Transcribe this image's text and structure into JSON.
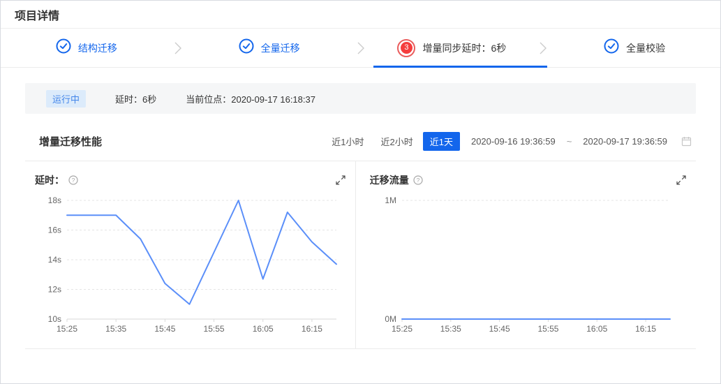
{
  "page": {
    "title": "项目详情"
  },
  "stepper": {
    "steps": [
      {
        "label": "结构迁移",
        "icon": "check-circle",
        "state": "done"
      },
      {
        "label": "全量迁移",
        "icon": "check-circle",
        "state": "done"
      },
      {
        "label": "增量同步延时：6秒",
        "icon": "number-badge",
        "badge": "3",
        "state": "active"
      },
      {
        "label": "全量校验",
        "icon": "check-circle",
        "state": "done"
      }
    ]
  },
  "status_bar": {
    "state": "运行中",
    "delay": "延时：6秒",
    "checkpoint": "当前位点：2020-09-17 16:18:37"
  },
  "performance": {
    "title": "增量迁移性能",
    "range_tabs": [
      {
        "label": "近1小时",
        "selected": false
      },
      {
        "label": "近2小时",
        "selected": false
      },
      {
        "label": "近1天",
        "selected": true
      }
    ],
    "date_from": "2020-09-16 19:36:59",
    "date_separator": "~",
    "date_to": "2020-09-17 19:36:59"
  },
  "colors": {
    "primary_blue": "#1366ec",
    "line_blue": "#5b8ff9",
    "badge_red": "#f53d3d",
    "status_badge_bg": "#dcebfb",
    "status_badge_text": "#4486ea"
  },
  "chart_data": [
    {
      "type": "line",
      "title": "延时：",
      "x": [
        "15:25",
        "15:30",
        "15:35",
        "15:40",
        "15:45",
        "15:50",
        "15:55",
        "16:00",
        "16:05",
        "16:10",
        "16:15",
        "16:20"
      ],
      "values": [
        17,
        17,
        17,
        15.4,
        12.4,
        11,
        14.5,
        18,
        12.7,
        17.2,
        15.2,
        13.7
      ],
      "x_ticks": [
        "15:25",
        "15:35",
        "15:45",
        "15:55",
        "16:05",
        "16:15"
      ],
      "y_ticks": [
        {
          "v": 10,
          "label": "10s"
        },
        {
          "v": 12,
          "label": "12s"
        },
        {
          "v": 14,
          "label": "14s"
        },
        {
          "v": 16,
          "label": "16s"
        },
        {
          "v": 18,
          "label": "18s"
        }
      ],
      "ylim": [
        10,
        18
      ],
      "line_color": "#5b8ff9",
      "grid": "dashed",
      "legend": "none"
    },
    {
      "type": "line",
      "title": "迁移流量",
      "x": [
        "15:25",
        "15:30",
        "15:35",
        "15:40",
        "15:45",
        "15:50",
        "15:55",
        "16:00",
        "16:05",
        "16:10",
        "16:15",
        "16:20"
      ],
      "values": [
        0,
        0,
        0,
        0,
        0,
        0,
        0,
        0,
        0,
        0,
        0,
        0
      ],
      "x_ticks": [
        "15:25",
        "15:35",
        "15:45",
        "15:55",
        "16:05",
        "16:15"
      ],
      "y_ticks": [
        {
          "v": 0,
          "label": "0M"
        },
        {
          "v": 1,
          "label": "1M"
        }
      ],
      "ylim": [
        0,
        1
      ],
      "line_color": "#5b8ff9",
      "grid": "dashed",
      "legend": "none"
    }
  ]
}
